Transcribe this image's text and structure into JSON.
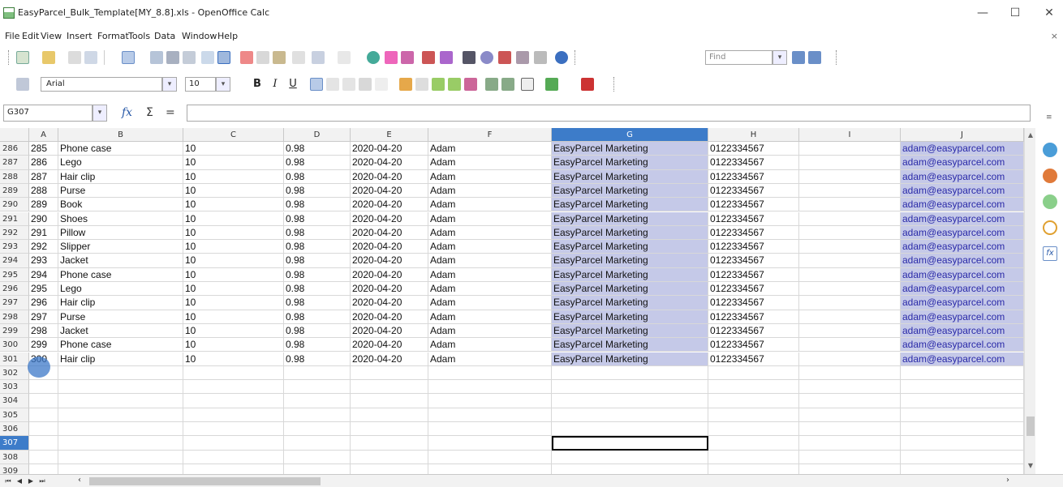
{
  "window": {
    "title": "EasyParcel_Bulk_Template[MY_8.8].xls - OpenOffice Calc",
    "minimize": "—",
    "maximize": "☐",
    "close": "✕"
  },
  "menu": [
    "File",
    "Edit",
    "View",
    "Insert",
    "Format",
    "Tools",
    "Data",
    "Window",
    "Help"
  ],
  "close_doc": "×",
  "toolbar": {
    "find_placeholder": "Find"
  },
  "format_bar": {
    "font_name": "Arial",
    "font_size": "10",
    "bold": "B",
    "italic": "I",
    "underline": "U"
  },
  "formula_bar": {
    "name_box": "G307",
    "fx": "fx",
    "sum": "Σ",
    "equals": "="
  },
  "columns": [
    "A",
    "B",
    "C",
    "D",
    "E",
    "F",
    "G",
    "H",
    "I",
    "J"
  ],
  "selected_column": "G",
  "rows": [
    {
      "n": "286",
      "a": "285",
      "b": "Phone case",
      "c": "10",
      "d": "0.98",
      "e": "2020-04-20",
      "f": "Adam",
      "g": "EasyParcel Marketing",
      "h": "0122334567",
      "j": "adam@easyparcel.com"
    },
    {
      "n": "287",
      "a": "286",
      "b": "Lego",
      "c": "10",
      "d": "0.98",
      "e": "2020-04-20",
      "f": "Adam",
      "g": "EasyParcel Marketing",
      "h": "0122334567",
      "j": "adam@easyparcel.com"
    },
    {
      "n": "288",
      "a": "287",
      "b": "Hair clip",
      "c": "10",
      "d": "0.98",
      "e": "2020-04-20",
      "f": "Adam",
      "g": "EasyParcel Marketing",
      "h": "0122334567",
      "j": "adam@easyparcel.com"
    },
    {
      "n": "289",
      "a": "288",
      "b": "Purse",
      "c": "10",
      "d": "0.98",
      "e": "2020-04-20",
      "f": "Adam",
      "g": "EasyParcel Marketing",
      "h": "0122334567",
      "j": "adam@easyparcel.com"
    },
    {
      "n": "290",
      "a": "289",
      "b": "Book",
      "c": "10",
      "d": "0.98",
      "e": "2020-04-20",
      "f": "Adam",
      "g": "EasyParcel Marketing",
      "h": "0122334567",
      "j": "adam@easyparcel.com"
    },
    {
      "n": "291",
      "a": "290",
      "b": "Shoes",
      "c": "10",
      "d": "0.98",
      "e": "2020-04-20",
      "f": "Adam",
      "g": "EasyParcel Marketing",
      "h": "0122334567",
      "j": "adam@easyparcel.com"
    },
    {
      "n": "292",
      "a": "291",
      "b": "Pillow",
      "c": "10",
      "d": "0.98",
      "e": "2020-04-20",
      "f": "Adam",
      "g": "EasyParcel Marketing",
      "h": "0122334567",
      "j": "adam@easyparcel.com"
    },
    {
      "n": "293",
      "a": "292",
      "b": "Slipper",
      "c": "10",
      "d": "0.98",
      "e": "2020-04-20",
      "f": "Adam",
      "g": "EasyParcel Marketing",
      "h": "0122334567",
      "j": "adam@easyparcel.com"
    },
    {
      "n": "294",
      "a": "293",
      "b": "Jacket",
      "c": "10",
      "d": "0.98",
      "e": "2020-04-20",
      "f": "Adam",
      "g": "EasyParcel Marketing",
      "h": "0122334567",
      "j": "adam@easyparcel.com"
    },
    {
      "n": "295",
      "a": "294",
      "b": "Phone case",
      "c": "10",
      "d": "0.98",
      "e": "2020-04-20",
      "f": "Adam",
      "g": "EasyParcel Marketing",
      "h": "0122334567",
      "j": "adam@easyparcel.com"
    },
    {
      "n": "296",
      "a": "295",
      "b": "Lego",
      "c": "10",
      "d": "0.98",
      "e": "2020-04-20",
      "f": "Adam",
      "g": "EasyParcel Marketing",
      "h": "0122334567",
      "j": "adam@easyparcel.com"
    },
    {
      "n": "297",
      "a": "296",
      "b": "Hair clip",
      "c": "10",
      "d": "0.98",
      "e": "2020-04-20",
      "f": "Adam",
      "g": "EasyParcel Marketing",
      "h": "0122334567",
      "j": "adam@easyparcel.com"
    },
    {
      "n": "298",
      "a": "297",
      "b": "Purse",
      "c": "10",
      "d": "0.98",
      "e": "2020-04-20",
      "f": "Adam",
      "g": "EasyParcel Marketing",
      "h": "0122334567",
      "j": "adam@easyparcel.com"
    },
    {
      "n": "299",
      "a": "298",
      "b": "Jacket",
      "c": "10",
      "d": "0.98",
      "e": "2020-04-20",
      "f": "Adam",
      "g": "EasyParcel Marketing",
      "h": "0122334567",
      "j": "adam@easyparcel.com"
    },
    {
      "n": "300",
      "a": "299",
      "b": "Phone case",
      "c": "10",
      "d": "0.98",
      "e": "2020-04-20",
      "f": "Adam",
      "g": "EasyParcel Marketing",
      "h": "0122334567",
      "j": "adam@easyparcel.com"
    },
    {
      "n": "301",
      "a": "300",
      "b": "Hair clip",
      "c": "10",
      "d": "0.98",
      "e": "2020-04-20",
      "f": "Adam",
      "g": "EasyParcel Marketing",
      "h": "0122334567",
      "j": "adam@easyparcel.com"
    },
    {
      "n": "302"
    },
    {
      "n": "303"
    },
    {
      "n": "304"
    },
    {
      "n": "305"
    },
    {
      "n": "306"
    },
    {
      "n": "307",
      "active": true
    },
    {
      "n": "308"
    },
    {
      "n": "309"
    }
  ],
  "colors": {
    "selection_header": "#3d7cc9",
    "selection_cells": "#c5c9e8",
    "email_text": "#2a2aa8"
  }
}
